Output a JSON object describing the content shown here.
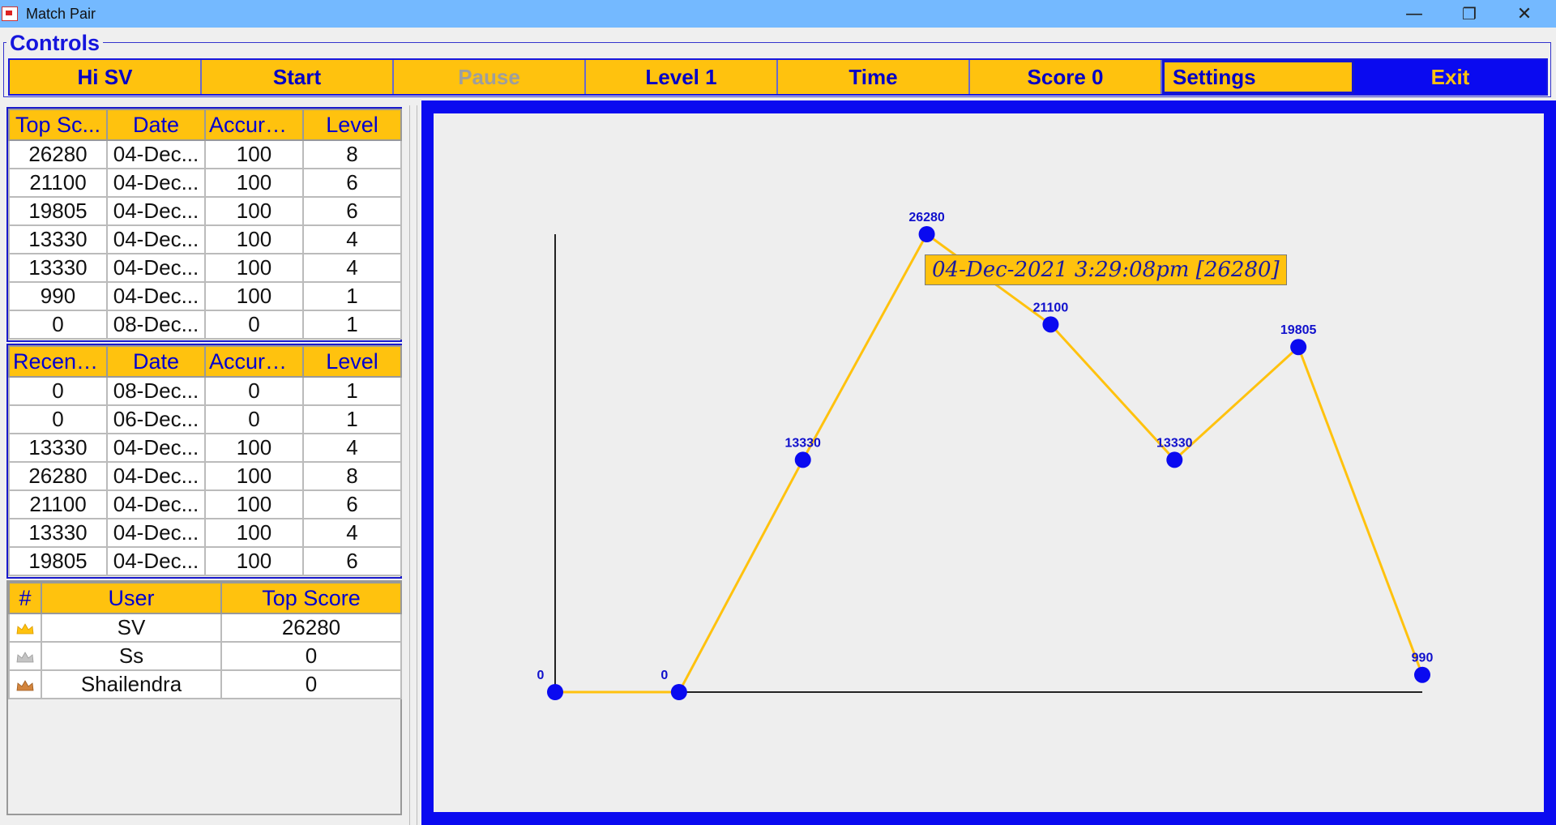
{
  "window": {
    "title": "Match Pair",
    "minimize_glyph": "—",
    "restore_glyph": "❐",
    "close_glyph": "✕"
  },
  "controls": {
    "legend": "Controls",
    "buttons": {
      "greeting": "Hi SV",
      "start": "Start",
      "pause": "Pause",
      "level": "Level 1",
      "time": "Time",
      "score": "Score 0",
      "settings": "Settings",
      "exit": "Exit"
    }
  },
  "top_scores": {
    "headers": [
      "Top Sc...",
      "Date",
      "Accuracy",
      "Level"
    ],
    "rows": [
      [
        "26280",
        "04-Dec...",
        "100",
        "8"
      ],
      [
        "21100",
        "04-Dec...",
        "100",
        "6"
      ],
      [
        "19805",
        "04-Dec...",
        "100",
        "6"
      ],
      [
        "13330",
        "04-Dec...",
        "100",
        "4"
      ],
      [
        "13330",
        "04-Dec...",
        "100",
        "4"
      ],
      [
        "990",
        "04-Dec...",
        "100",
        "1"
      ],
      [
        "0",
        "08-Dec...",
        "0",
        "1"
      ]
    ]
  },
  "recent_scores": {
    "headers": [
      "Recent ...",
      "Date",
      "Accuracy",
      "Level"
    ],
    "rows": [
      [
        "0",
        "08-Dec...",
        "0",
        "1"
      ],
      [
        "0",
        "06-Dec...",
        "0",
        "1"
      ],
      [
        "13330",
        "04-Dec...",
        "100",
        "4"
      ],
      [
        "26280",
        "04-Dec...",
        "100",
        "8"
      ],
      [
        "21100",
        "04-Dec...",
        "100",
        "6"
      ],
      [
        "13330",
        "04-Dec...",
        "100",
        "4"
      ],
      [
        "19805",
        "04-Dec...",
        "100",
        "6"
      ]
    ]
  },
  "users": {
    "headers": [
      "#",
      "User",
      "Top Score"
    ],
    "rows": [
      {
        "crown": "gold-crown-icon",
        "crown_color": "#ffc20e",
        "user": "SV",
        "score": "26280"
      },
      {
        "crown": "silver-crown-icon",
        "crown_color": "#b8b8b8",
        "user": "Ss",
        "score": "0"
      },
      {
        "crown": "bronze-crown-icon",
        "crown_color": "#c87533",
        "user": "Shailendra",
        "score": "0"
      }
    ]
  },
  "colors": {
    "accent": "#ffc20e",
    "primary_blue": "#0a0af0",
    "line": "#ffc20e",
    "point": "#0a0af0"
  },
  "chart_data": {
    "type": "line",
    "x": [
      1,
      2,
      3,
      4,
      5,
      6,
      7,
      8
    ],
    "values": [
      0,
      0,
      13330,
      26280,
      21100,
      13330,
      19805,
      990
    ],
    "point_labels": [
      "0",
      "0",
      "13330",
      "26280",
      "21100",
      "13330",
      "19805",
      "990"
    ],
    "ylim": [
      0,
      26280
    ],
    "grid": false,
    "tooltip": "04-Dec-2021 3:29:08pm [26280]"
  }
}
